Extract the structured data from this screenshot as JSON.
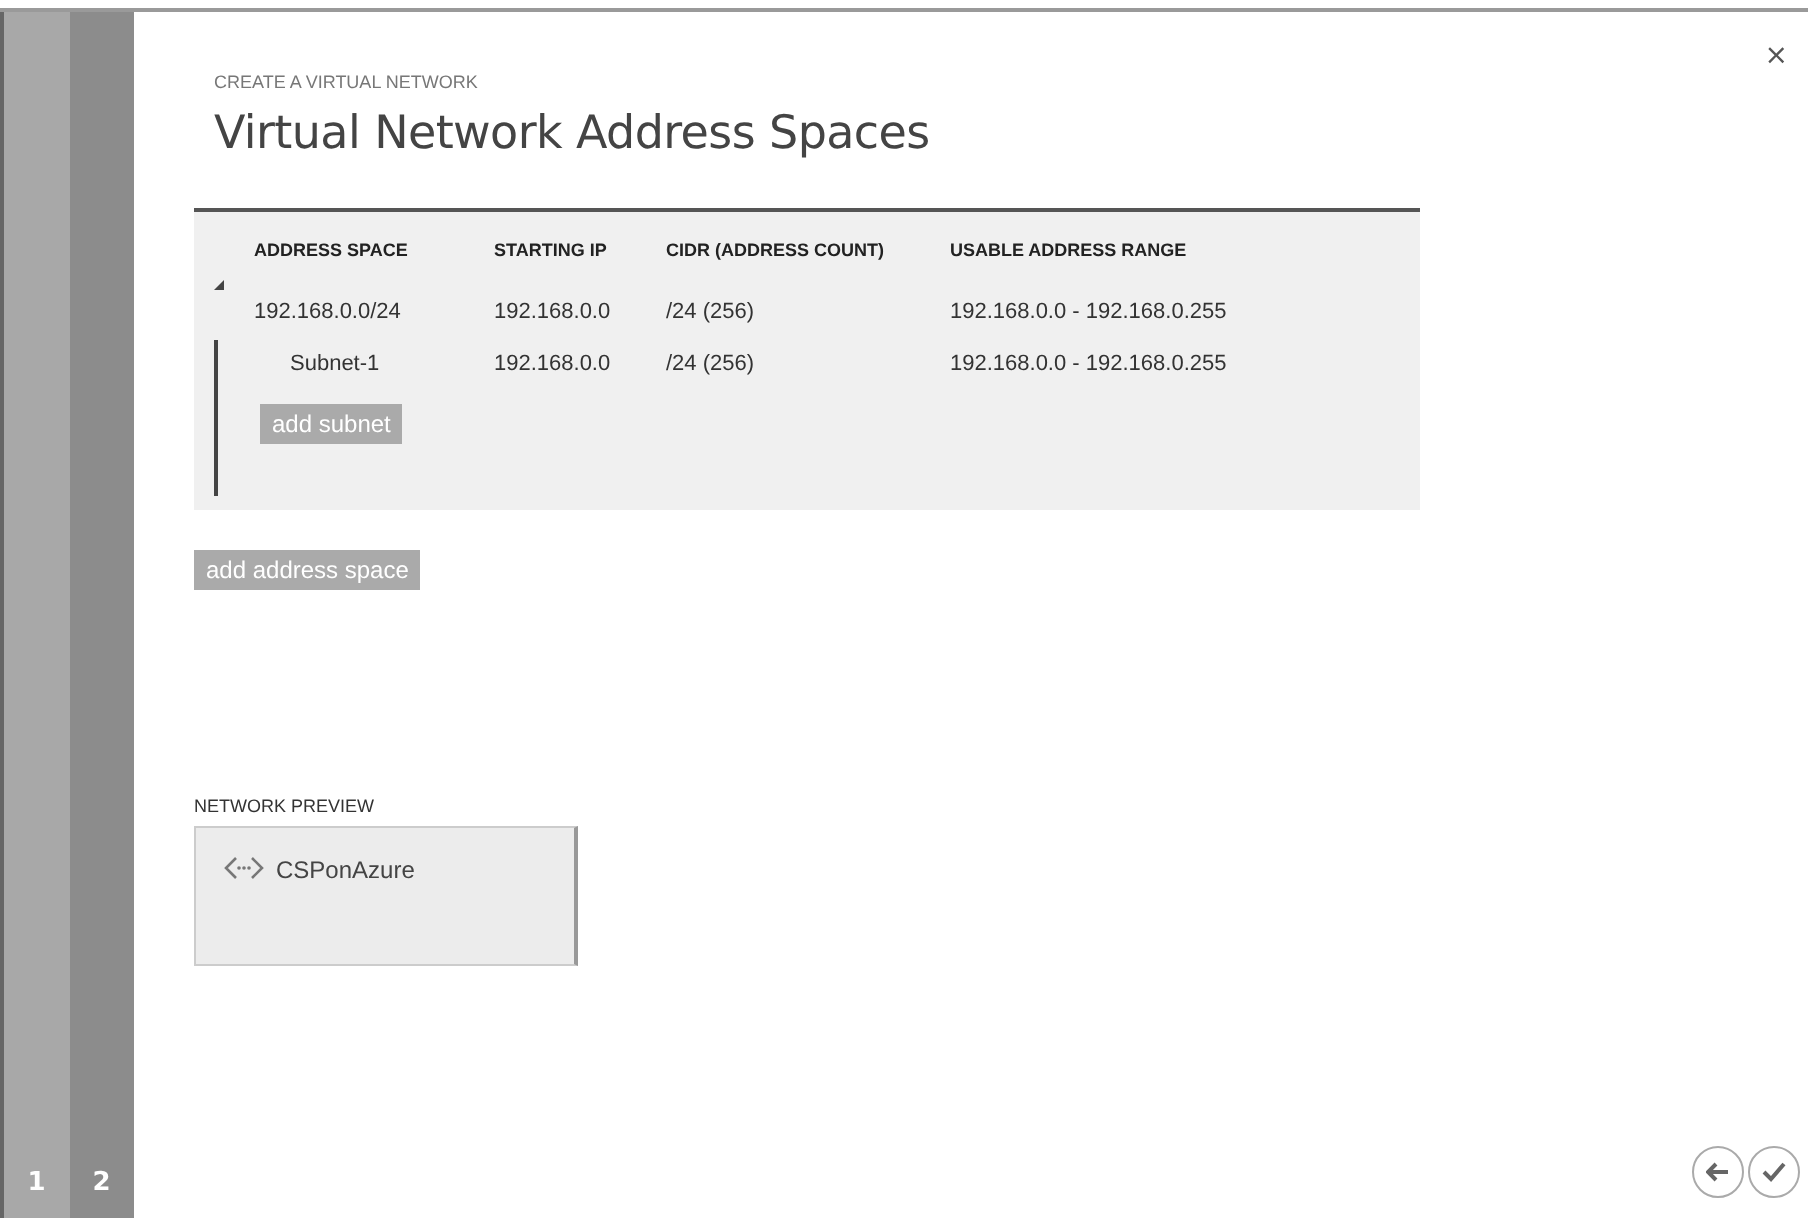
{
  "steps": [
    {
      "label": "1",
      "selected": false
    },
    {
      "label": "2",
      "selected": true
    }
  ],
  "close": "×",
  "wizard_title": "CREATE A VIRTUAL NETWORK",
  "heading": "Virtual Network Address Spaces",
  "table": {
    "expanded": true,
    "columns": [
      "ADDRESS SPACE",
      "STARTING IP",
      "CIDR (ADDRESS COUNT)",
      "USABLE ADDRESS RANGE"
    ],
    "rows": [
      [
        "192.168.0.0/24",
        "192.168.0.0",
        "/24 (256)",
        "192.168.0.0 - 192.168.0.255"
      ]
    ],
    "subnets": [
      [
        "Subnet-1",
        "192.168.0.0",
        "/24 (256)",
        "192.168.0.0 - 192.168.0.255"
      ]
    ],
    "add_subnet": "add subnet"
  },
  "add_address_space": "add address space",
  "network_preview": {
    "label": "NETWORK PREVIEW",
    "name": "CSPonAzure"
  }
}
